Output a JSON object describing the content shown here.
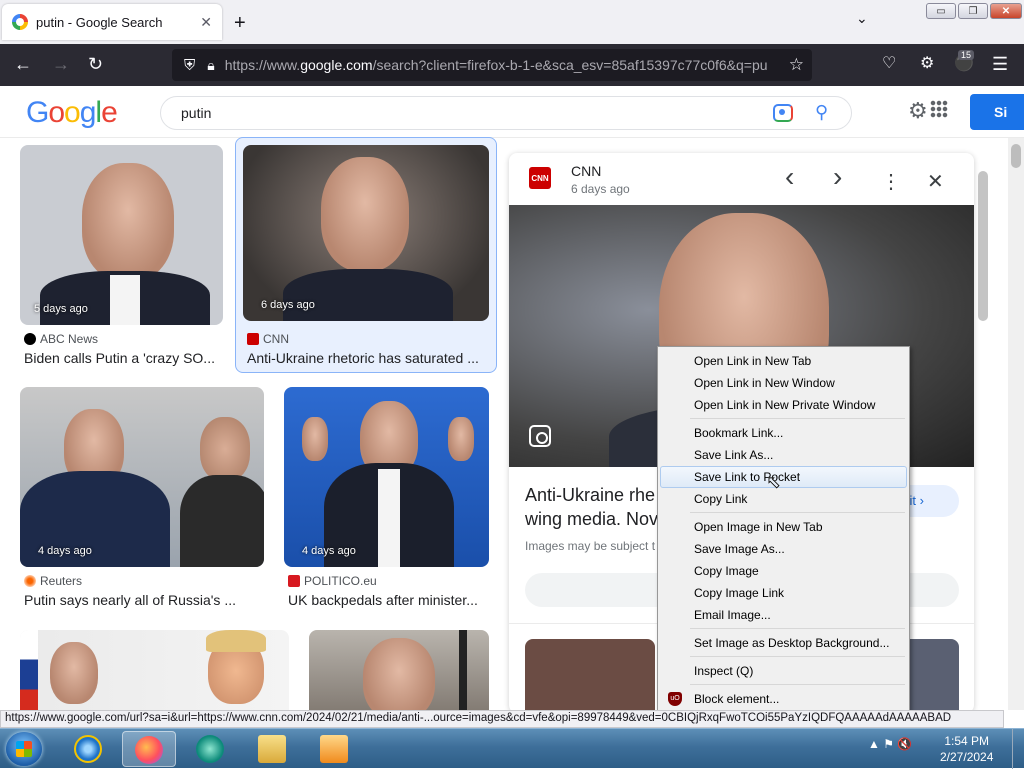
{
  "browser": {
    "tab_title": "putin - Google Search",
    "tab_close": "✕",
    "new_tab": "+",
    "list_tabs": "⌄",
    "url_prefix": "https://www.",
    "url_domain": "google.com",
    "url_rest": "/search?client=firefox-b-1-e&sca_esv=85af15397c77c0f6&q=pu",
    "extension_badge": "15",
    "window_controls": {
      "minimize": "▭",
      "maximize": "❐",
      "close": "✕"
    }
  },
  "google": {
    "logo": [
      "G",
      "o",
      "o",
      "g",
      "l",
      "e"
    ],
    "query": "putin",
    "signin_label": "Si"
  },
  "results": [
    {
      "when": "5 days ago",
      "source": "ABC News",
      "caption": "Biden calls Putin a 'crazy SO...",
      "fav_color": "#000000"
    },
    {
      "when": "6 days ago",
      "source": "CNN",
      "caption": "Anti-Ukraine rhetoric has saturated ...",
      "fav_color": "#cc0000"
    },
    {
      "when": "4 days ago",
      "source": "Reuters",
      "caption": "Putin says nearly all of Russia's ...",
      "fav_color": "#fa6400"
    },
    {
      "when": "4 days ago",
      "source": "POLITICO.eu",
      "caption": "UK backpedals after minister...",
      "fav_color": "#d71920"
    }
  ],
  "panel": {
    "source": "CNN",
    "logo_text": "CNN",
    "when": "6 days ago",
    "title": "Anti-Ukraine rhe... wing media. Nov...",
    "title_line1": "Anti-Ukraine rhe",
    "title_line2": "wing media. Nov",
    "note": "Images may be subject t",
    "visit_label": "sit",
    "icons": {
      "prev": "‹",
      "next": "›",
      "more": "⋮",
      "close": "✕"
    }
  },
  "context_menu": {
    "items": [
      {
        "label": "Open Link in New Tab"
      },
      {
        "label": "Open Link in New Window"
      },
      {
        "label": "Open Link in New Private Window"
      },
      {
        "label": "Bookmark Link..."
      },
      {
        "label": "Save Link As..."
      },
      {
        "label": "Save Link to Pocket"
      },
      {
        "label": "Copy Link"
      },
      {
        "label": "Open Image in New Tab"
      },
      {
        "label": "Save Image As..."
      },
      {
        "label": "Copy Image"
      },
      {
        "label": "Copy Image Link"
      },
      {
        "label": "Email Image..."
      },
      {
        "label": "Set Image as Desktop Background..."
      },
      {
        "label": "Inspect (Q)"
      },
      {
        "label": "Block element..."
      }
    ],
    "highlighted": "Save Link to Pocket",
    "ublock_badge": "uO"
  },
  "status_url": "https://www.google.com/url?sa=i&url=https://www.cnn.com/2024/02/21/media/anti-...ource=images&cd=vfe&opi=89978449&ved=0CBIQjRxqFwoTCOi55PaYzIQDFQAAAAAdAAAAABAD",
  "taskbar": {
    "time": "1:54 PM",
    "date": "2/27/2024",
    "tray_icons": "▲ ⚑ 🔇"
  },
  "colors": {
    "accent": "#1a73e8",
    "firefox_toolbar": "#2b2a33",
    "menu_highlight": "#dfeaf7"
  }
}
